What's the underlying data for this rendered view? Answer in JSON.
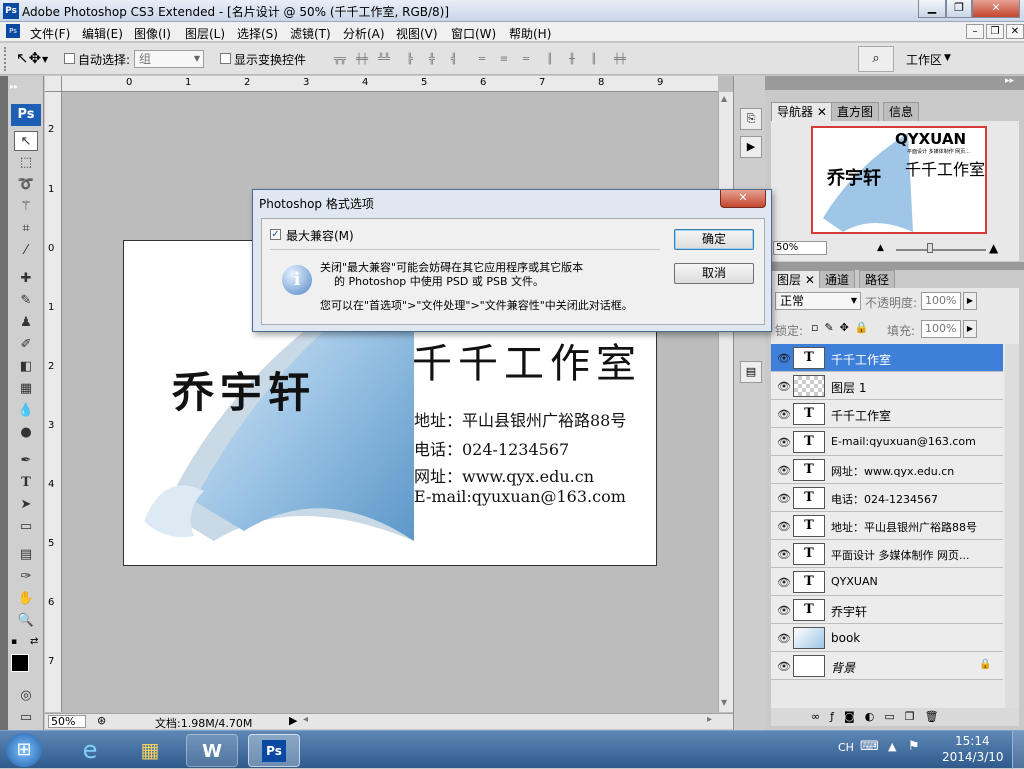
{
  "window": {
    "title": "Adobe Photoshop CS3 Extended - [名片设计 @ 50% (千千工作室, RGB/8)]"
  },
  "menu": {
    "items": [
      "文件(F)",
      "编辑(E)",
      "图像(I)",
      "图层(L)",
      "选择(S)",
      "滤镜(T)",
      "分析(A)",
      "视图(V)",
      "窗口(W)",
      "帮助(H)"
    ]
  },
  "options": {
    "auto_select_label": "自动选择:",
    "auto_select_value": "组",
    "show_transform_label": "显示变换控件",
    "workspace_label": "工作区"
  },
  "ruler": {
    "h_ticks": [
      "0",
      "1",
      "2",
      "3",
      "4",
      "5",
      "6",
      "7",
      "8",
      "9"
    ],
    "v_ticks": [
      "2",
      "1",
      "0",
      "1",
      "2",
      "3",
      "4",
      "5",
      "6",
      "7"
    ]
  },
  "canvas": {
    "name": "乔宇轩",
    "company": "千千工作室",
    "address": "地址：平山县银州广裕路88号",
    "phone": "电话：024-1234567",
    "website": "网址：www.qyx.edu.cn",
    "email": "E-mail:qyuxuan@163.com"
  },
  "status": {
    "zoom": "50%",
    "doc": "文档:1.98M/4.70M"
  },
  "navigator": {
    "tabs": [
      "导航器",
      "直方图",
      "信息"
    ],
    "zoom": "50%",
    "thumb_title": "QYXUAN",
    "thumb_company": "千千工作室",
    "thumb_name": "乔宇轩",
    "thumb_sub": "平面设计 多媒体制作 网页..."
  },
  "layers": {
    "tabs": [
      "图层",
      "通道",
      "路径"
    ],
    "blend_mode": "正常",
    "opacity_label": "不透明度:",
    "opacity": "100%",
    "lock_label": "锁定:",
    "fill_label": "填充:",
    "fill": "100%",
    "items": [
      {
        "name": "千千工作室",
        "type": "text",
        "selected": true
      },
      {
        "name": "图层 1",
        "type": "raster"
      },
      {
        "name": "千千工作室",
        "type": "text"
      },
      {
        "name": "E-mail:qyuxuan@163.com",
        "type": "text"
      },
      {
        "name": "网址：www.qyx.edu.cn",
        "type": "text"
      },
      {
        "name": "电话：024-1234567",
        "type": "text"
      },
      {
        "name": "地址：平山县银州广裕路88号",
        "type": "text"
      },
      {
        "name": "平面设计 多媒体制作 网页...",
        "type": "text"
      },
      {
        "name": "QYXUAN",
        "type": "text"
      },
      {
        "name": "乔宇轩",
        "type": "text"
      },
      {
        "name": "book",
        "type": "smart"
      },
      {
        "name": "背景",
        "type": "background"
      }
    ]
  },
  "dialog": {
    "title": "Photoshop 格式选项",
    "checkbox_label": "最大兼容(M)",
    "message_line1": "关闭\"最大兼容\"可能会妨碍在其它应用程序或其它版本",
    "message_line2": "的 Photoshop 中使用 PSD 或 PSB 文件。",
    "message_line3": "您可以在\"首选项\">\"文件处理\">\"文件兼容性\"中关闭此对话框。",
    "ok_label": "确定",
    "cancel_label": "取消"
  },
  "taskbar": {
    "lang": "CH",
    "time": "15:14",
    "date": "2014/3/10"
  },
  "colors": {
    "selection": "#3d7fd9",
    "ps_blue": "#1c5fb4",
    "taskbar": "#2f5b8c"
  }
}
